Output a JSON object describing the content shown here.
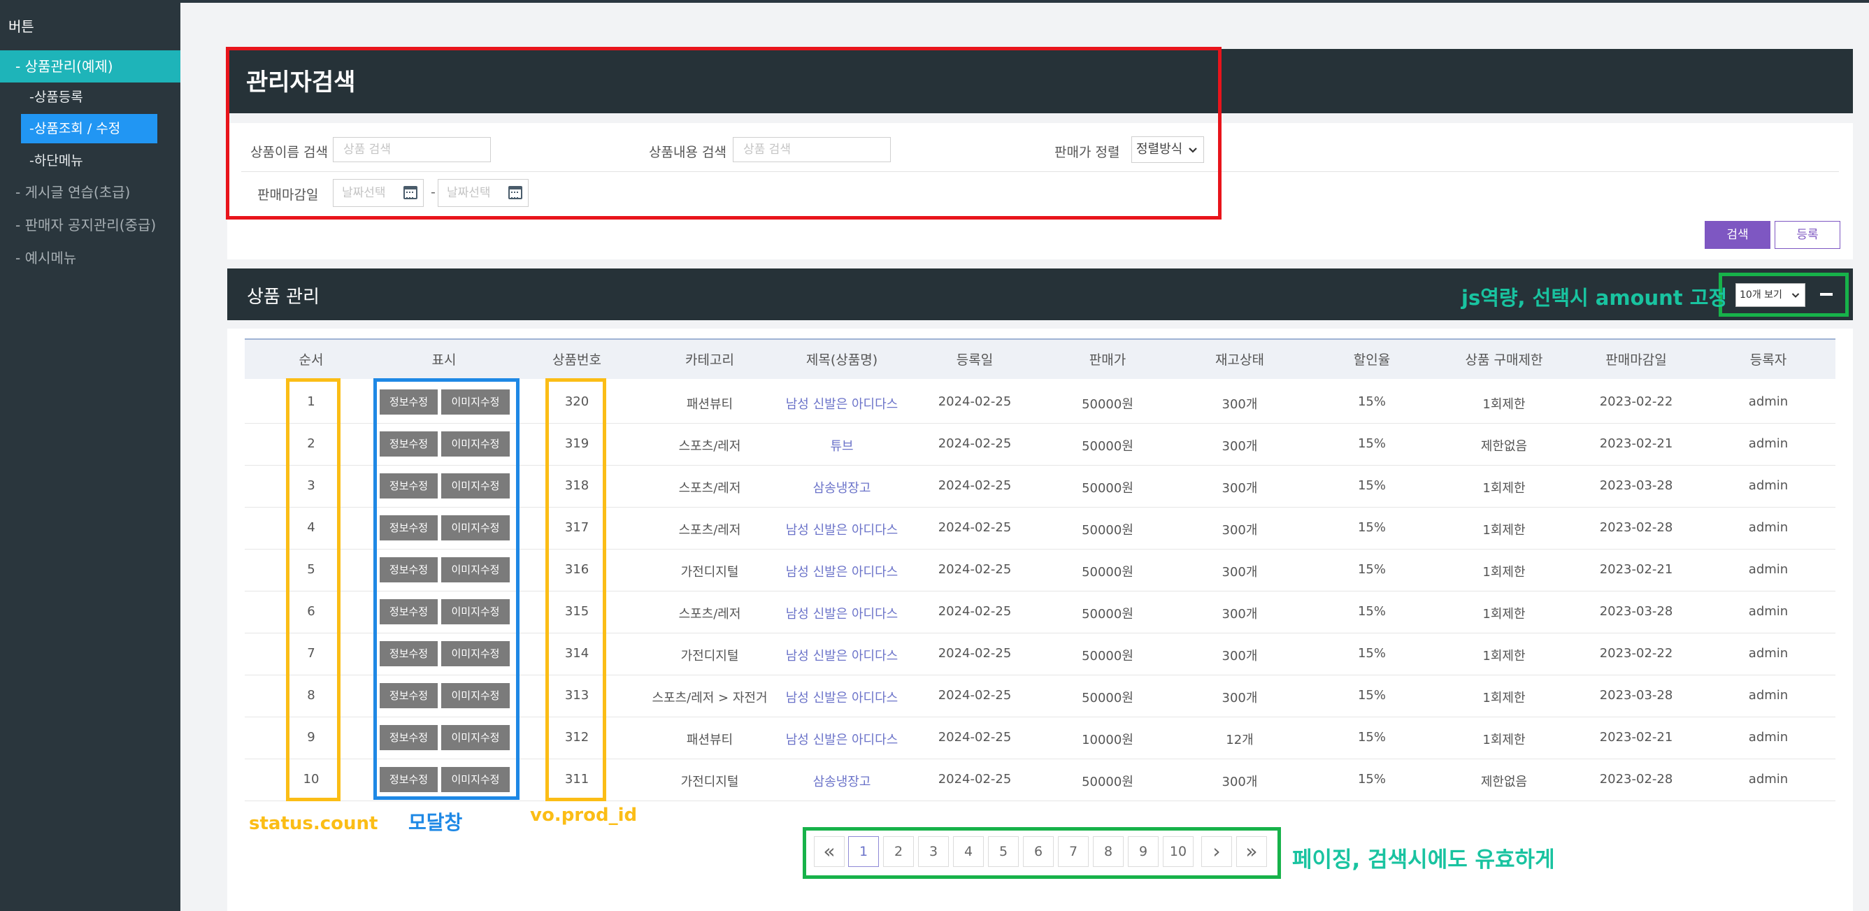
{
  "sidebar": {
    "brand": "버튼",
    "categories": [
      {
        "label": "- 상품관리(예제)"
      },
      {
        "label": "- 게시글 연습(초급)"
      },
      {
        "label": "- 판매자 공지관리(중급)"
      },
      {
        "label": "- 예시메뉴"
      }
    ],
    "subitems": [
      {
        "label": "-상품등록"
      },
      {
        "label": "-상품조회 / 수정"
      },
      {
        "label": "-하단메뉴"
      }
    ]
  },
  "search": {
    "title": "관리자검색",
    "name_label": "상품이름 검색",
    "name_placeholder": "상품 검색",
    "content_label": "상품내용 검색",
    "content_placeholder": "상품 검색",
    "sort_label": "판매가 정렬",
    "sort_value": "정렬방식",
    "deadline_label": "판매마감일",
    "date_placeholder": "날짜선택",
    "date_separator": "-",
    "search_button": "검색",
    "register_button": "등록"
  },
  "product": {
    "title": "상품 관리",
    "amount_select": "10개 보기"
  },
  "table": {
    "headers": [
      "순서",
      "표시",
      "상품번호",
      "카테고리",
      "제목(상품명)",
      "등록일",
      "판매가",
      "재고상태",
      "할인율",
      "상품 구매제한",
      "판매마감일",
      "등록자"
    ],
    "edit_info_label": "정보수정",
    "edit_image_label": "이미지수정",
    "rows": [
      {
        "no": "1",
        "id": "320",
        "category": "패션뷰티",
        "title": "남성 신발은 아디다스",
        "date": "2024-02-25",
        "price": "50000원",
        "stock": "300개",
        "discount": "15%",
        "limit": "1회제한",
        "deadline": "2023-02-22",
        "author": "admin"
      },
      {
        "no": "2",
        "id": "319",
        "category": "스포츠/레저",
        "title": "튜브",
        "date": "2024-02-25",
        "price": "50000원",
        "stock": "300개",
        "discount": "15%",
        "limit": "제한없음",
        "deadline": "2023-02-21",
        "author": "admin"
      },
      {
        "no": "3",
        "id": "318",
        "category": "스포츠/레저",
        "title": "삼송냉장고",
        "date": "2024-02-25",
        "price": "50000원",
        "stock": "300개",
        "discount": "15%",
        "limit": "1회제한",
        "deadline": "2023-03-28",
        "author": "admin"
      },
      {
        "no": "4",
        "id": "317",
        "category": "스포츠/레저",
        "title": "남성 신발은 아디다스",
        "date": "2024-02-25",
        "price": "50000원",
        "stock": "300개",
        "discount": "15%",
        "limit": "1회제한",
        "deadline": "2023-02-28",
        "author": "admin"
      },
      {
        "no": "5",
        "id": "316",
        "category": "가전디지털",
        "title": "남성 신발은 아디다스",
        "date": "2024-02-25",
        "price": "50000원",
        "stock": "300개",
        "discount": "15%",
        "limit": "1회제한",
        "deadline": "2023-02-21",
        "author": "admin"
      },
      {
        "no": "6",
        "id": "315",
        "category": "스포츠/레저",
        "title": "남성 신발은 아디다스",
        "date": "2024-02-25",
        "price": "50000원",
        "stock": "300개",
        "discount": "15%",
        "limit": "1회제한",
        "deadline": "2023-03-28",
        "author": "admin"
      },
      {
        "no": "7",
        "id": "314",
        "category": "가전디지털",
        "title": "남성 신발은 아디다스",
        "date": "2024-02-25",
        "price": "50000원",
        "stock": "300개",
        "discount": "15%",
        "limit": "1회제한",
        "deadline": "2023-02-22",
        "author": "admin"
      },
      {
        "no": "8",
        "id": "313",
        "category": "스포츠/레저 > 자전거",
        "title": "남성 신발은 아디다스",
        "date": "2024-02-25",
        "price": "50000원",
        "stock": "300개",
        "discount": "15%",
        "limit": "1회제한",
        "deadline": "2023-03-28",
        "author": "admin"
      },
      {
        "no": "9",
        "id": "312",
        "category": "패션뷰티",
        "title": "남성 신발은 아디다스",
        "date": "2024-02-25",
        "price": "10000원",
        "stock": "12개",
        "discount": "15%",
        "limit": "1회제한",
        "deadline": "2023-02-21",
        "author": "admin"
      },
      {
        "no": "10",
        "id": "311",
        "category": "가전디지털",
        "title": "삼송냉장고",
        "date": "2024-02-25",
        "price": "50000원",
        "stock": "300개",
        "discount": "15%",
        "limit": "제한없음",
        "deadline": "2023-02-28",
        "author": "admin"
      }
    ]
  },
  "pagination": {
    "first_icon": "double-chevron-left-icon",
    "prev_icon": "chevron-left-icon",
    "next_icon": "chevron-right-icon",
    "last_icon": "double-chevron-right-icon",
    "first": "«",
    "next": "›",
    "last": "»",
    "pages": [
      "1",
      "2",
      "3",
      "4",
      "5",
      "6",
      "7",
      "8",
      "9",
      "10"
    ],
    "current": "1"
  },
  "annotations": {
    "amount_note": "js역량, 선택시 amount 고정",
    "status_count": "status.count",
    "modal": "모달창",
    "prod_id": "vo.prod_id",
    "paging_note": "페이징, 검색시에도 유효하게"
  },
  "colors": {
    "red": "#e8141b",
    "yellow": "#fbbd16",
    "blue": "#1e88e5",
    "green": "#17b24a",
    "teal": "#1eb4b9"
  }
}
